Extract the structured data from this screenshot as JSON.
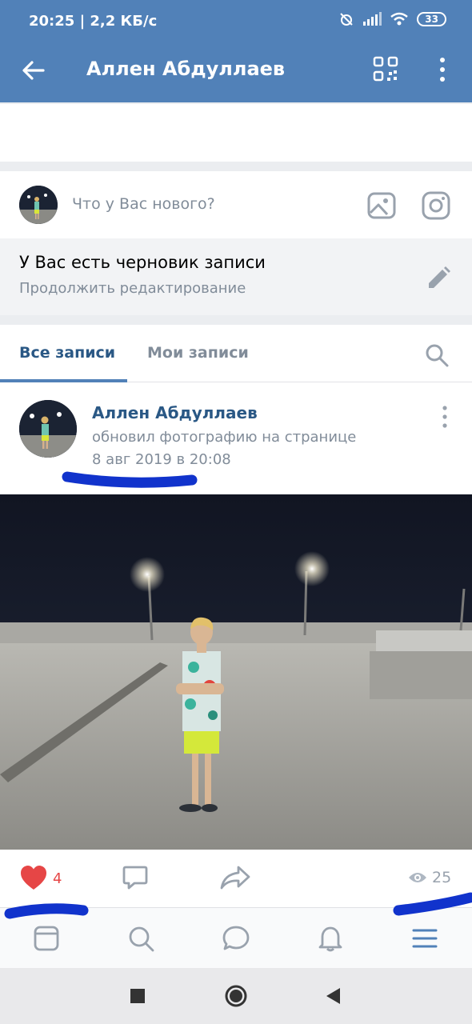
{
  "status": {
    "time": "20:25 | 2,2 КБ/с",
    "battery": "33"
  },
  "header": {
    "title": "Аллен Абдуллаев"
  },
  "composer": {
    "placeholder": "Что у Вас нового?"
  },
  "draft": {
    "title": "У Вас есть черновик записи",
    "subtitle": "Продолжить редактирование"
  },
  "tabs": [
    {
      "label": "Все записи",
      "active": true
    },
    {
      "label": "Мои записи",
      "active": false
    }
  ],
  "post": {
    "author": "Аллен Абдуллаев",
    "action": "обновил фотографию на странице",
    "date": "8 авг 2019 в 20:08",
    "likes": "4",
    "views": "25"
  },
  "colors": {
    "header_blue": "#5181b8",
    "link_blue": "#2a5885",
    "like_red": "#e64646",
    "secondary_text": "#818c99"
  },
  "icons": {
    "header": [
      "back-arrow-icon",
      "qr-code-icon",
      "more-vertical-icon"
    ],
    "composer": [
      "photo-icon",
      "instagram-icon"
    ],
    "draft": "pencil-icon",
    "tabs": "search-icon",
    "post_actions": [
      "heart-icon",
      "comment-icon",
      "share-icon",
      "eye-icon"
    ],
    "bottom_nav": [
      "news-feed-icon",
      "search-icon",
      "messages-icon",
      "notifications-icon",
      "menu-icon"
    ],
    "system_nav": [
      "recent-apps-icon",
      "home-icon",
      "back-icon"
    ]
  }
}
